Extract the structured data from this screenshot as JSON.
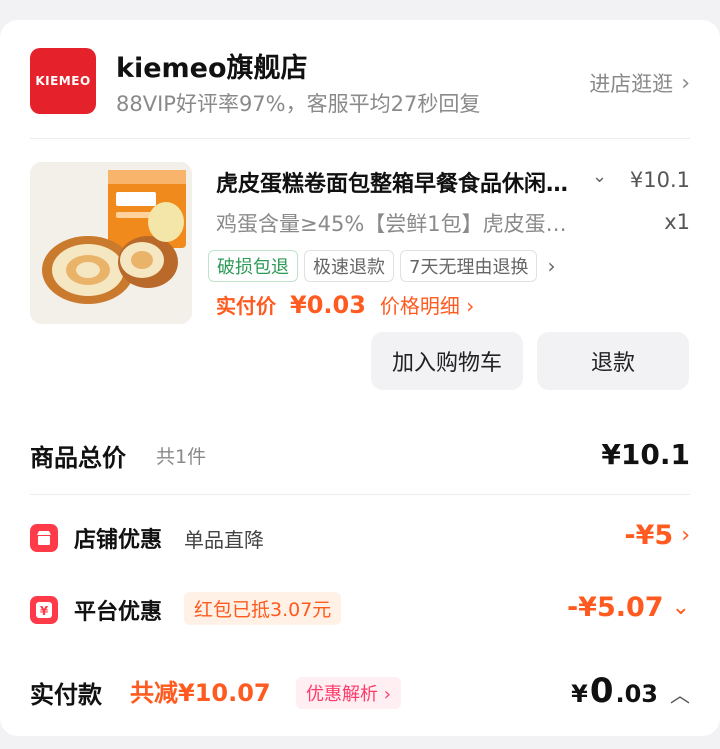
{
  "colors": {
    "accent": "#ff5a1f",
    "brand": "#e5222c",
    "green": "#2d9a56"
  },
  "shop": {
    "logo_text": "KIEMEO",
    "name": "kiemeo旗舰店",
    "subtitle": "88VIP好评率97%，客服平均27秒回复",
    "visit_label": "进店逛逛"
  },
  "product": {
    "title": "虎皮蛋糕卷面包整箱早餐食品休闲零食",
    "price": "¥10.1",
    "spec": "鸡蛋含量≥45%【尝鲜1包】虎皮蛋糕卷",
    "qty": "x1",
    "tags": [
      "破损包退",
      "极速退款",
      "7天无理由退换"
    ],
    "paid_label": "实付价",
    "paid_amount": "¥0.03",
    "price_detail": "价格明细",
    "add_to_cart": "加入购物车",
    "refund": "退款"
  },
  "summary": {
    "title": "商品总价",
    "count": "共1件",
    "value": "¥10.1"
  },
  "discounts": {
    "shop": {
      "label": "店铺优惠",
      "sub": "单品直降",
      "value": "-¥5",
      "icon": "shop-icon"
    },
    "platform": {
      "label": "平台优惠",
      "chip": "红包已抵3.07元",
      "value": "-¥5.07",
      "icon": "yen-icon"
    }
  },
  "total": {
    "label": "实付款",
    "reduce": "共减¥10.07",
    "chip": "优惠解析",
    "yen": "¥",
    "int": "0",
    "dec": ".03"
  }
}
